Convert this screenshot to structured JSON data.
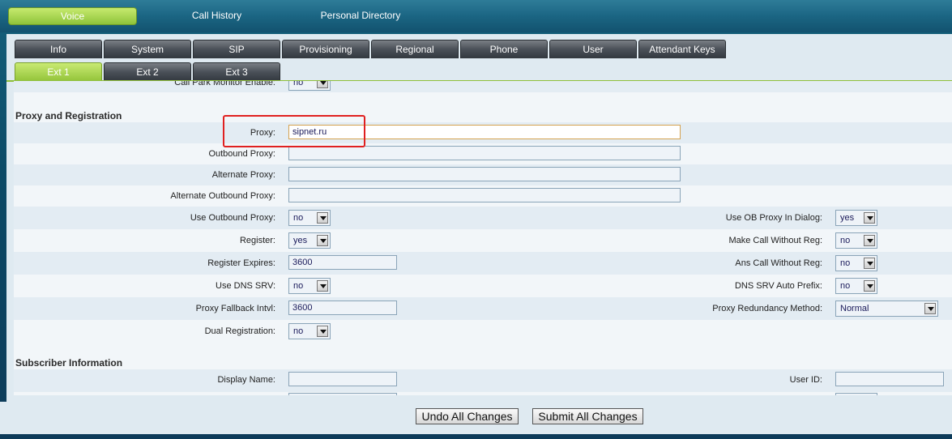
{
  "topnav": {
    "tabs": [
      {
        "label": "Voice",
        "active": true
      },
      {
        "label": "Call History",
        "active": false
      },
      {
        "label": "Personal Directory",
        "active": false
      }
    ]
  },
  "main_tabs": [
    "Info",
    "System",
    "SIP",
    "Provisioning",
    "Regional",
    "Phone",
    "User",
    "Attendant Keys"
  ],
  "ext_tabs": [
    {
      "label": "Ext 1",
      "active": true
    },
    {
      "label": "Ext 2",
      "active": false
    },
    {
      "label": "Ext 3",
      "active": false
    }
  ],
  "partial_row": {
    "label": "Call Park Monitor Enable:",
    "value": "no"
  },
  "proxy_section": {
    "title": "Proxy and Registration",
    "proxy": {
      "label": "Proxy:",
      "value": "sipnet.ru"
    },
    "outbound_proxy": {
      "label": "Outbound Proxy:",
      "value": ""
    },
    "alternate_proxy": {
      "label": "Alternate Proxy:",
      "value": ""
    },
    "alternate_outbound_proxy": {
      "label": "Alternate Outbound Proxy:",
      "value": ""
    },
    "use_outbound_proxy": {
      "label": "Use Outbound Proxy:",
      "value": "no"
    },
    "use_ob_proxy_in_dialog": {
      "label": "Use OB Proxy In Dialog:",
      "value": "yes"
    },
    "register": {
      "label": "Register:",
      "value": "yes"
    },
    "make_call_without_reg": {
      "label": "Make Call Without Reg:",
      "value": "no"
    },
    "register_expires": {
      "label": "Register Expires:",
      "value": "3600"
    },
    "ans_call_without_reg": {
      "label": "Ans Call Without Reg:",
      "value": "no"
    },
    "use_dns_srv": {
      "label": "Use DNS SRV:",
      "value": "no"
    },
    "dns_srv_auto_prefix": {
      "label": "DNS SRV Auto Prefix:",
      "value": "no"
    },
    "proxy_fallback_intvl": {
      "label": "Proxy Fallback Intvl:",
      "value": "3600"
    },
    "proxy_redundancy_method": {
      "label": "Proxy Redundancy Method:",
      "value": "Normal"
    },
    "dual_registration": {
      "label": "Dual Registration:",
      "value": "no"
    }
  },
  "subscriber_section": {
    "title": "Subscriber Information",
    "display_name": {
      "label": "Display Name:",
      "value": ""
    },
    "user_id": {
      "label": "User ID:",
      "value": ""
    }
  },
  "buttons": {
    "undo": "Undo All Changes",
    "submit": "Submit All Changes"
  },
  "colors": {
    "accent_green": "#93c43a",
    "highlight_red": "#e02020"
  }
}
